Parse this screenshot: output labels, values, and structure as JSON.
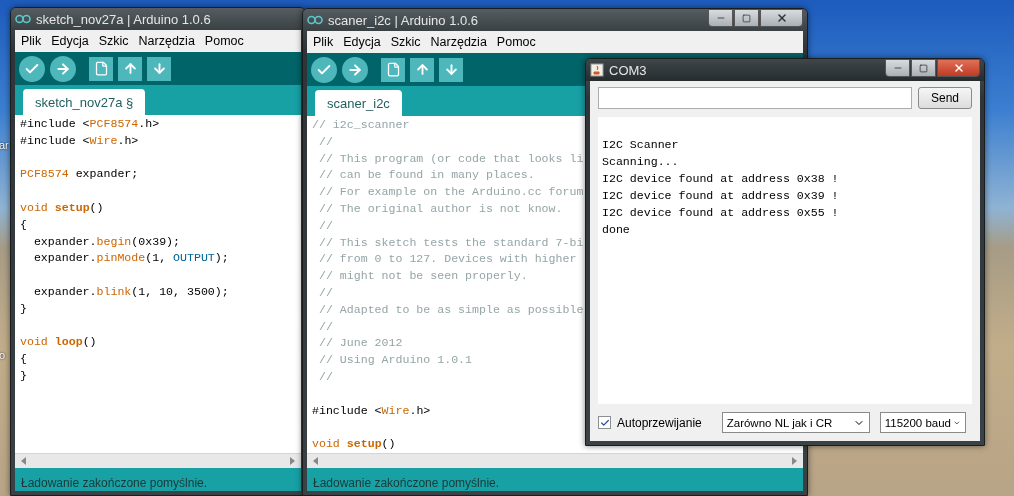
{
  "desktop": {
    "icon_labels": [
      "ar",
      "o"
    ]
  },
  "windows": [
    {
      "kind": "ide",
      "title": "sketch_nov27a | Arduino 1.0.6",
      "menu": [
        "Plik",
        "Edycja",
        "Szkic",
        "Narzędzia",
        "Pomoc"
      ],
      "tabs": [
        {
          "label": "sketch_nov27a §",
          "selected": true
        }
      ],
      "code": [
        {
          "kind": "code",
          "segments": [
            {
              "text": "#include <",
              "kind": "plain"
            },
            {
              "text": "PCF8574",
              "kind": "type"
            },
            {
              "text": ".h>",
              "kind": "plain"
            }
          ]
        },
        {
          "kind": "code",
          "segments": [
            {
              "text": "#include <",
              "kind": "plain"
            },
            {
              "text": "Wire",
              "kind": "type"
            },
            {
              "text": ".h>",
              "kind": "plain"
            }
          ]
        },
        {
          "kind": "blank"
        },
        {
          "kind": "code",
          "segments": [
            {
              "text": "PCF8574",
              "kind": "type"
            },
            {
              "text": " expander;",
              "kind": "plain"
            }
          ]
        },
        {
          "kind": "blank"
        },
        {
          "kind": "code",
          "segments": [
            {
              "text": "void ",
              "kind": "type"
            },
            {
              "text": "setup",
              "kind": "function"
            },
            {
              "text": "()",
              "kind": "plain"
            }
          ]
        },
        {
          "kind": "code",
          "segments": [
            {
              "text": "{",
              "kind": "plain"
            }
          ]
        },
        {
          "kind": "code",
          "segments": [
            {
              "text": "  expander.",
              "kind": "plain"
            },
            {
              "text": "begin",
              "kind": "type"
            },
            {
              "text": "(0x39);",
              "kind": "plain"
            }
          ]
        },
        {
          "kind": "code",
          "segments": [
            {
              "text": "  expander.",
              "kind": "plain"
            },
            {
              "text": "pinMode",
              "kind": "type"
            },
            {
              "text": "(1, ",
              "kind": "plain"
            },
            {
              "text": "OUTPUT",
              "kind": "constant"
            },
            {
              "text": ");",
              "kind": "plain"
            }
          ]
        },
        {
          "kind": "blank"
        },
        {
          "kind": "code",
          "segments": [
            {
              "text": "  expander.",
              "kind": "plain"
            },
            {
              "text": "blink",
              "kind": "type"
            },
            {
              "text": "(1, 10, 3500);",
              "kind": "plain"
            }
          ]
        },
        {
          "kind": "code",
          "segments": [
            {
              "text": "}",
              "kind": "plain"
            }
          ]
        },
        {
          "kind": "blank"
        },
        {
          "kind": "code",
          "segments": [
            {
              "text": "void ",
              "kind": "type"
            },
            {
              "text": "loop",
              "kind": "function"
            },
            {
              "text": "()",
              "kind": "plain"
            }
          ]
        },
        {
          "kind": "code",
          "segments": [
            {
              "text": "{",
              "kind": "plain"
            }
          ]
        },
        {
          "kind": "code",
          "segments": [
            {
              "text": "}",
              "kind": "plain"
            }
          ]
        }
      ],
      "status": "Ładowanie zakończone pomyślnie."
    },
    {
      "kind": "ide",
      "title": "scaner_i2c | Arduino 1.0.6",
      "active": false,
      "menu": [
        "Plik",
        "Edycja",
        "Szkic",
        "Narzędzia",
        "Pomoc"
      ],
      "tabs": [
        {
          "label": "scaner_i2c",
          "selected": true
        }
      ],
      "code": [
        {
          "kind": "code",
          "segments": [
            {
              "text": "// i2c_scanner",
              "kind": "comment"
            }
          ]
        },
        {
          "kind": "code",
          "segments": [
            {
              "text": " //",
              "kind": "comment"
            }
          ]
        },
        {
          "kind": "code",
          "segments": [
            {
              "text": " // This program (or code that looks li",
              "kind": "comment"
            }
          ]
        },
        {
          "kind": "code",
          "segments": [
            {
              "text": " // can be found in many places.",
              "kind": "comment"
            }
          ]
        },
        {
          "kind": "code",
          "segments": [
            {
              "text": " // For example on the Arduino.cc forum",
              "kind": "comment"
            }
          ]
        },
        {
          "kind": "code",
          "segments": [
            {
              "text": " // The original author is not know.",
              "kind": "comment"
            }
          ]
        },
        {
          "kind": "code",
          "segments": [
            {
              "text": " //",
              "kind": "comment"
            }
          ]
        },
        {
          "kind": "code",
          "segments": [
            {
              "text": " // This sketch tests the standard 7-bi",
              "kind": "comment"
            }
          ]
        },
        {
          "kind": "code",
          "segments": [
            {
              "text": " // from 0 to 127. Devices with higher",
              "kind": "comment"
            }
          ]
        },
        {
          "kind": "code",
          "segments": [
            {
              "text": " // might not be seen properly.",
              "kind": "comment"
            }
          ]
        },
        {
          "kind": "code",
          "segments": [
            {
              "text": " //",
              "kind": "comment"
            }
          ]
        },
        {
          "kind": "code",
          "segments": [
            {
              "text": " // Adapted to be as simple as possible",
              "kind": "comment"
            }
          ]
        },
        {
          "kind": "code",
          "segments": [
            {
              "text": " //",
              "kind": "comment"
            }
          ]
        },
        {
          "kind": "code",
          "segments": [
            {
              "text": " // June 2012",
              "kind": "comment"
            }
          ]
        },
        {
          "kind": "code",
          "segments": [
            {
              "text": " // Using Arduino 1.0.1",
              "kind": "comment"
            }
          ]
        },
        {
          "kind": "code",
          "segments": [
            {
              "text": " //",
              "kind": "comment"
            }
          ]
        },
        {
          "kind": "blank"
        },
        {
          "kind": "code",
          "segments": [
            {
              "text": "#include <",
              "kind": "plain"
            },
            {
              "text": "Wire",
              "kind": "type"
            },
            {
              "text": ".h>",
              "kind": "plain"
            }
          ]
        },
        {
          "kind": "blank"
        },
        {
          "kind": "code",
          "segments": [
            {
              "text": "void ",
              "kind": "type"
            },
            {
              "text": "setup",
              "kind": "function"
            },
            {
              "text": "()",
              "kind": "plain"
            }
          ]
        }
      ],
      "status": "Ładowanie zakończone pomyślnie."
    },
    {
      "kind": "serial",
      "title": "COM3",
      "active": true,
      "send": "Send",
      "output": [
        "I2C Scanner",
        "Scanning...",
        "I2C device found at address 0x38 !",
        "I2C device found at address 0x39 !",
        "I2C device found at address 0x55 !",
        "done"
      ],
      "autoscroll": {
        "label": "Autoprzewijanie",
        "checked": true
      },
      "line_ending": "Zarówno NL jak i CR",
      "baud": "115200 baud"
    }
  ]
}
